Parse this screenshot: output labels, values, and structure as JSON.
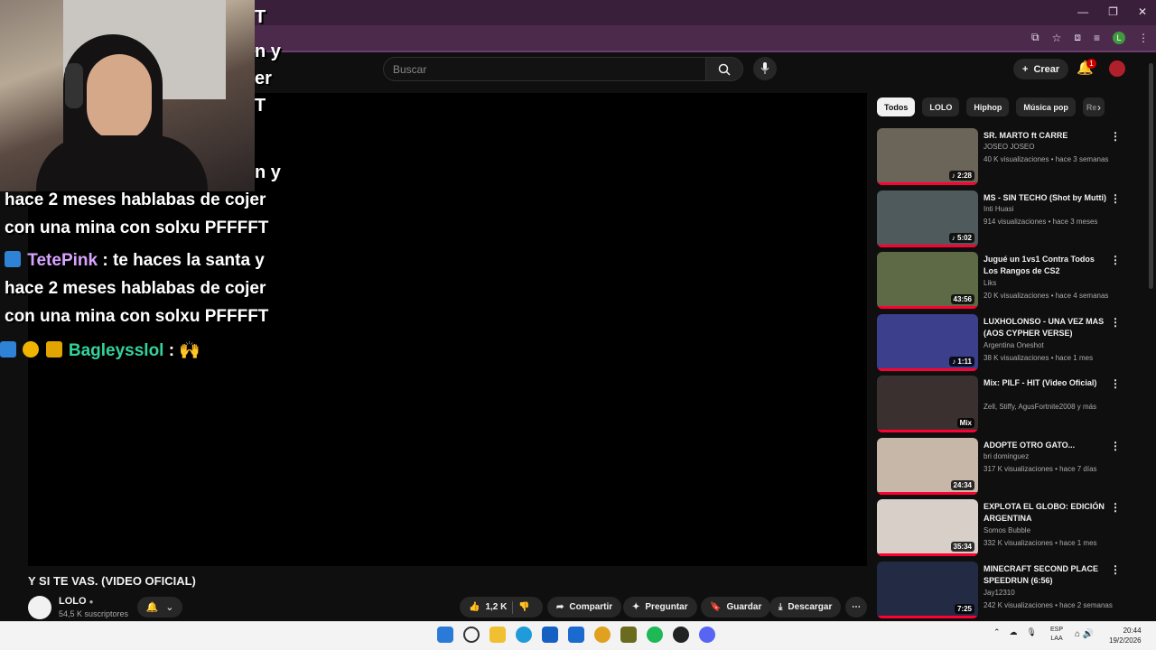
{
  "chat_fragments": [
    "T",
    "n y",
    "er",
    "T",
    "n y"
  ],
  "chat_lines": [
    "hace 2 meses hablabas de cojer",
    "con una mina con solxu PFFFFT",
    "TetePink",
    ": te haces la santa y",
    "hace 2 meses hablabas de cojer",
    "con una mina con solxu PFFFFT",
    "Bagleysslol",
    ":"
  ],
  "search": {
    "placeholder": "Buscar"
  },
  "header": {
    "create_label": "Crear",
    "notification_count": "1"
  },
  "video": {
    "title": "Y SI TE VAS. (VIDEO OFICIAL)",
    "channel": "LOLO",
    "subscribers": "54,5 K suscriptores",
    "likes": "1,2 K",
    "share_label": "Compartir",
    "ask_label": "Preguntar",
    "save_label": "Guardar",
    "download_label": "Descargar"
  },
  "chips": [
    "Todos",
    "LOLO",
    "Hiphop",
    "Música pop",
    "Re"
  ],
  "recommendations": [
    {
      "title": "SR. MARTO ft CARRE",
      "channel": "JOSEO JOSEO",
      "meta": "40 K visualizaciones • hace 3 semanas",
      "duration": "♪ 2:28",
      "thumb": "#6b6458"
    },
    {
      "title": "MS - SIN TECHO (Shot by Mutti)",
      "channel": "Inti Huasi",
      "meta": "914 visualizaciones • hace 3 meses",
      "duration": "♪ 5:02",
      "thumb": "#4f5a5c"
    },
    {
      "title": "Jugué un 1vs1 Contra Todos Los Rangos de CS2",
      "channel": "Liks",
      "meta": "20 K visualizaciones • hace 4 semanas",
      "duration": "43:56",
      "thumb": "#5d6a45"
    },
    {
      "title": "LUXHOLONSO - UNA VEZ MAS (AOS CYPHER VERSE)",
      "channel": "Argentina Oneshot",
      "meta": "38 K visualizaciones • hace 1 mes",
      "duration": "♪ 1:11",
      "thumb": "#3b3f8c"
    },
    {
      "title": "Mix: PILF - HIT (Video Oficial)",
      "channel": "Zell, Stiffy, AgusFortnite2008 y más",
      "meta": "",
      "duration": "Mix",
      "thumb": "#3a3030"
    },
    {
      "title": "ADOPTE OTRO GATO...",
      "channel": "bri dominguez",
      "meta": "317 K visualizaciones • hace 7 días",
      "duration": "24:34",
      "thumb": "#c7b7a8"
    },
    {
      "title": "EXPLOTA EL GLOBO: EDICIÓN ARGENTINA",
      "channel": "Somos Bubble",
      "meta": "332 K visualizaciones • hace 1 mes",
      "duration": "35:34",
      "thumb": "#d8d0c8"
    },
    {
      "title": "MINECRAFT SECOND PLACE SPEEDRUN (6:56)",
      "channel": "Jay12310",
      "meta": "242 K visualizaciones • hace 2 semanas",
      "duration": "7:25",
      "thumb": "#222a44"
    }
  ],
  "taskbar": {
    "lang_top": "ESP",
    "lang_bottom": "LAA",
    "time": "20:44",
    "date": "19/2/2026"
  }
}
